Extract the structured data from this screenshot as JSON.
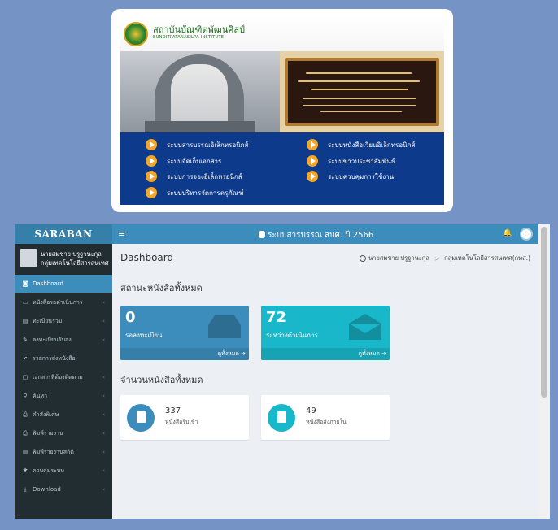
{
  "portal": {
    "institute_th": "สถาบันบัณฑิตพัฒนศิลป์",
    "institute_en": "BUNDITPATANASILPA INSTITUTE",
    "menu": [
      {
        "label": "ระบบสารบรรณอิเล็กทรอนิกส์"
      },
      {
        "label": "ระบบหนังสือเวียนอิเล็กทรอนิกส์"
      },
      {
        "label": "ระบบจัดเก็บเอกสาร"
      },
      {
        "label": "ระบบข่าวประชาสัมพันธ์"
      },
      {
        "label": "ระบบการจองอิเล็กทรอนิกส์"
      },
      {
        "label": "ระบบควบคุมการใช้งาน"
      },
      {
        "label": "ระบบบริหารจัดการครุภัณฑ์"
      }
    ]
  },
  "app": {
    "logo": "SARABAN",
    "user": {
      "name": "นายสมชาย ปรูฐานะกุล",
      "group": "กลุ่มเทคโนโลยีสารสนเทศ"
    },
    "topbar": {
      "menu_icon": "≡",
      "title": "ระบบสารบรรณ สบศ. ปี 2566",
      "bell_icon": "🔔"
    },
    "sidebar": [
      {
        "label": "Dashboard",
        "icon": "dashboard-icon",
        "glyph": "◙",
        "active": true,
        "chev": ""
      },
      {
        "label": "หนังสือรอดำเนินการ",
        "icon": "inbox-icon",
        "glyph": "▭",
        "chev": "‹"
      },
      {
        "label": "ทะเบียนรวม",
        "icon": "book-icon",
        "glyph": "▤",
        "chev": "‹"
      },
      {
        "label": "ลงทะเบียนรับส่ง",
        "icon": "edit-icon",
        "glyph": "✎",
        "chev": "‹"
      },
      {
        "label": "รายการส่งหนังสือ",
        "icon": "send-icon",
        "glyph": "➚",
        "chev": ""
      },
      {
        "label": "เอกสารที่ต้องติดตาม",
        "icon": "bookmark-icon",
        "glyph": "▢",
        "chev": "‹"
      },
      {
        "label": "ค้นหา",
        "icon": "search-icon",
        "glyph": "⚲",
        "chev": "‹"
      },
      {
        "label": "คำสั่งพิเศษ",
        "icon": "print-icon",
        "glyph": "⎙",
        "chev": "‹"
      },
      {
        "label": "พิมพ์รายงาน",
        "icon": "report-icon",
        "glyph": "⎙",
        "chev": "‹"
      },
      {
        "label": "พิมพ์รายงานสถิติ",
        "icon": "chart-icon",
        "glyph": "▥",
        "chev": "‹"
      },
      {
        "label": "ควบคุมระบบ",
        "icon": "gear-icon",
        "glyph": "✱",
        "chev": "‹"
      },
      {
        "label": "Download",
        "icon": "download-icon",
        "glyph": "⤓",
        "chev": "‹"
      }
    ],
    "page_title": "Dashboard",
    "breadcrumb": {
      "user": "นายสมชาย ปรูฐานะกุล",
      "separator": ">",
      "group": "กลุ่มเทคโนโลยีสารสนเทศ(กทส.)"
    },
    "section_all": "สถานะหนังสือทั้งหมด",
    "section_count": "จำนวนหนังสือทั้งหมด",
    "status_boxes": [
      {
        "value": "0",
        "label": "รอลงทะเบียน",
        "link": "ดูทั้งหมด ➔"
      },
      {
        "value": "72",
        "label": "ระหว่างดำเนินการ",
        "link": "ดูทั้งหมด ➔"
      }
    ],
    "count_boxes": [
      {
        "value": "337",
        "label": "หนังสือรับเข้า"
      },
      {
        "value": "49",
        "label": "หนังสือส่งภายใน"
      }
    ]
  },
  "colors": {
    "primary": "#3c8dbc",
    "teal": "#18b7c9",
    "sidebar": "#222d32",
    "accent_orange": "#f5a623",
    "portal_blue": "#0e3a8c"
  }
}
